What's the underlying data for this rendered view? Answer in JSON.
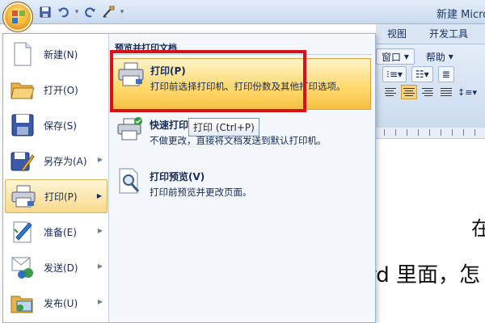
{
  "window": {
    "title": "新建 Micro"
  },
  "quick_access": [
    {
      "name": "save-icon"
    },
    {
      "name": "undo-icon"
    },
    {
      "name": "redo-icon"
    },
    {
      "name": "format-painter-icon"
    },
    {
      "name": "customize-icon"
    }
  ],
  "ribbon": {
    "tabs": [
      "视图",
      "开发工具"
    ],
    "row1": [
      "窗口",
      "帮助"
    ]
  },
  "document": {
    "line1": "在",
    "line2": "rd 里面，怎"
  },
  "office_menu": {
    "items": [
      {
        "label": "新建(N)",
        "icon": "new-document-icon",
        "arrow": false
      },
      {
        "label": "打开(O)",
        "icon": "open-folder-icon",
        "arrow": false
      },
      {
        "label": "保存(S)",
        "icon": "save-disk-icon",
        "arrow": false
      },
      {
        "label": "另存为(A)",
        "icon": "save-as-icon",
        "arrow": true
      },
      {
        "label": "打印(P)",
        "icon": "printer-icon",
        "arrow": true,
        "selected": true
      },
      {
        "label": "准备(E)",
        "icon": "prepare-icon",
        "arrow": true
      },
      {
        "label": "发送(D)",
        "icon": "send-icon",
        "arrow": true
      },
      {
        "label": "发布(U)",
        "icon": "publish-icon",
        "arrow": true
      }
    ],
    "submenu": {
      "header": "预览并打印文档",
      "items": [
        {
          "title": "打印(P)",
          "desc": "打印前选择打印机、打印份数及其他打印选项。",
          "icon": "printer-icon"
        },
        {
          "title": "快速打印(Q)",
          "desc": "不做更改，直接将文档发送到默认打印机。",
          "icon": "quick-print-icon"
        },
        {
          "title": "打印预览(V)",
          "desc": "打印前预览并更改页面。",
          "icon": "print-preview-icon"
        }
      ]
    },
    "tooltip": "打印 (Ctrl+P)"
  },
  "colors": {
    "accent_red": "#d7101a",
    "hover_gold": "#ffd86b",
    "menu_text": "#15295a"
  }
}
